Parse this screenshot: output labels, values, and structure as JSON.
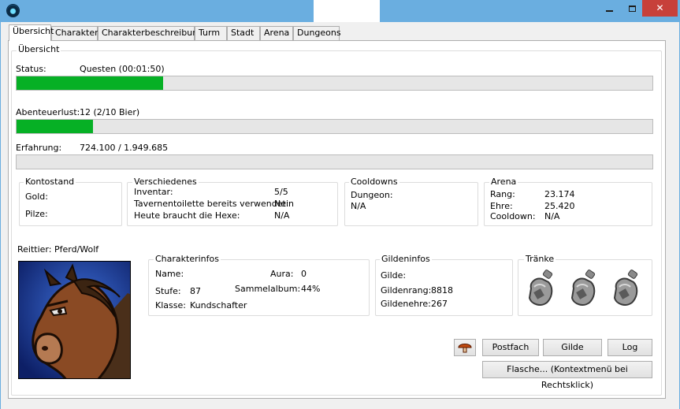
{
  "tabs": [
    "Übersicht",
    "Charakter",
    "Charakterbeschreibung",
    "Turm",
    "Stadt",
    "Arena",
    "Dungeons"
  ],
  "overview": {
    "group_title": "Übersicht",
    "status_label": "Status:",
    "status_value": "Questen (00:01:50)",
    "status_progress": 0.23,
    "adventure_label": "Abenteuerlust:",
    "adventure_value": "12 (2/10 Bier)",
    "adventure_progress": 0.12,
    "xp_label": "Erfahrung:",
    "xp_value": "724.100 / 1.949.685",
    "xp_progress": 0.0
  },
  "kontostand": {
    "title": "Kontostand",
    "gold_label": "Gold:",
    "pilze_label": "Pilze:"
  },
  "verschiedenes": {
    "title": "Verschiedenes",
    "rows": [
      {
        "label": "Inventar:",
        "value": "5/5"
      },
      {
        "label": "Tavernentoilette bereits verwendet:",
        "value": "Nein"
      },
      {
        "label": "Heute braucht die Hexe:",
        "value": "N/A"
      }
    ]
  },
  "cooldowns": {
    "title": "Cooldowns",
    "dungeon_label": "Dungeon:",
    "dungeon_value": "N/A"
  },
  "arena": {
    "title": "Arena",
    "rows": [
      {
        "label": "Rang:",
        "value": "23.174"
      },
      {
        "label": "Ehre:",
        "value": "25.420"
      },
      {
        "label": "Cooldown:",
        "value": "N/A"
      }
    ]
  },
  "mount": {
    "label": "Reittier:",
    "value": "Pferd/Wolf"
  },
  "charinfo": {
    "title": "Charakterinfos",
    "name_label": "Name:",
    "aura_label": "Aura:",
    "aura_value": "0",
    "level_label": "Stufe:",
    "level_value": "87",
    "album_label": "Sammelalbum:",
    "album_value": "44%",
    "class_label": "Klasse:",
    "class_value": "Kundschafter"
  },
  "guildinfo": {
    "title": "Gildeninfos",
    "guild_label": "Gilde:",
    "rank_label": "Gildenrang:",
    "rank_value": "8818",
    "honor_label": "Gildenehre:",
    "honor_value": "267"
  },
  "potions": {
    "title": "Tränke",
    "icons": [
      "potion-bottle-icon",
      "potion-bottle-icon",
      "potion-bottle-icon"
    ]
  },
  "buttons": {
    "mushroom_icon": "mushroom-icon",
    "postfach": "Postfach",
    "gilde": "Gilde",
    "log": "Log",
    "flasche": "Flasche... (Kontextmenü bei Rechtsklick)"
  },
  "colors": {
    "progress_fill": "#06b025",
    "titlebar": "#6aaee0",
    "close_button": "#c7403a"
  }
}
